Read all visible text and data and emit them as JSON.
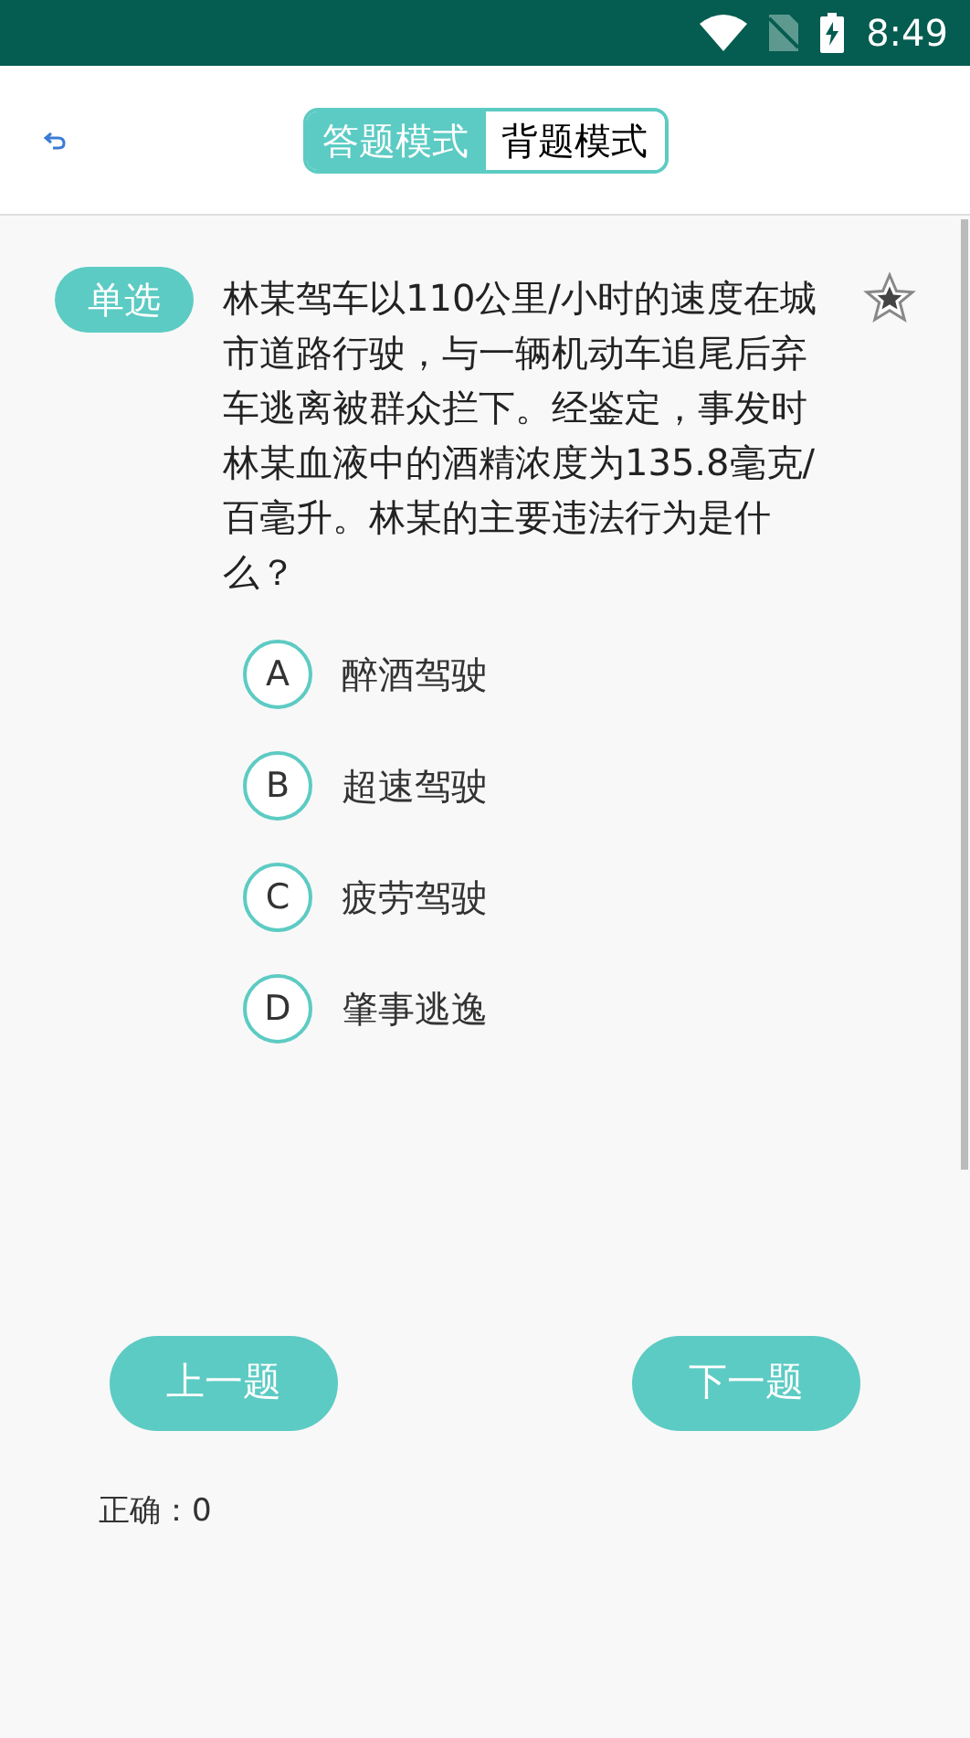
{
  "status_bar": {
    "time": "8:49"
  },
  "mode_tabs": [
    {
      "label": "答题模式",
      "selected": true
    },
    {
      "label": "背题模式",
      "selected": false
    }
  ],
  "question": {
    "type_badge": "单选",
    "text": "林某驾车以110公里/小时的速度在城市道路行驶，与一辆机动车追尾后弃车逃离被群众拦下。经鉴定，事发时林某血液中的酒精浓度为135.8毫克/百毫升。林某的主要违法行为是什么？",
    "starred": false
  },
  "options": [
    {
      "letter": "A",
      "text": "醉酒驾驶",
      "selected": false
    },
    {
      "letter": "B",
      "text": "超速驾驶",
      "selected": false
    },
    {
      "letter": "C",
      "text": "疲劳驾驶",
      "selected": false
    },
    {
      "letter": "D",
      "text": "肇事逃逸",
      "selected": false
    }
  ],
  "buttons": {
    "previous": "上一题",
    "next": "下一题"
  },
  "score": {
    "correct": "正确：0"
  }
}
